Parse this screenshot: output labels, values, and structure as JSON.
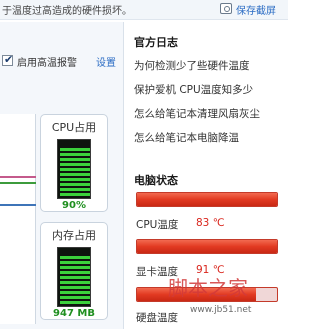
{
  "top": {
    "hint": "于温度过高造成的硬件损坏。",
    "save_label": "保存截屏"
  },
  "left": {
    "alarm_checked": true,
    "alarm_label": "启用高温报警",
    "settings_label": "设置",
    "cpu": {
      "title": "CPU占用",
      "value": "90%",
      "level": 0.9
    },
    "memory": {
      "title": "内存占用",
      "value": "947 MB",
      "level": 0.85
    }
  },
  "right": {
    "log_title": "官方日志",
    "log_items": [
      "为何检测少了些硬件温度",
      "保护爱机 CPU温度知多少",
      "怎么给笔记本清理风扇灰尘",
      "怎么给笔记本电脑降温"
    ],
    "status_title": "电脑状态",
    "status_items": [
      {
        "label": "CPU温度",
        "value": "83 ℃",
        "level": 1.0
      },
      {
        "label": "显卡温度",
        "value": "91 ℃",
        "level": 1.0
      },
      {
        "label": "硬盘温度",
        "value": "",
        "level": 0.85
      }
    ]
  },
  "colors": {
    "accent": "#2b6cc4",
    "hot": "#d9251c",
    "meter_green": "#3bd13b"
  },
  "watermark": {
    "text": "脚本之家",
    "url": "www.jb51.net"
  }
}
